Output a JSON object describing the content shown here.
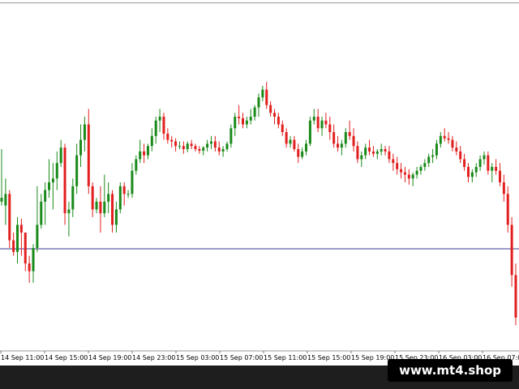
{
  "chart_data": {
    "type": "candlestick",
    "timeframe_label_note": "",
    "time_labels": [
      "14 Sep 11:00",
      "14 Sep 15:00",
      "14 Sep 19:00",
      "14 Sep 23:00",
      "15 Sep 03:00",
      "15 Sep 07:00",
      "15 Sep 11:00",
      "15 Sep 15:00",
      "15 Sep 19:00",
      "15 Sep 23:00",
      "16 Sep 03:00",
      "16 Sep 07:00"
    ],
    "ylim": [
      0,
      451
    ],
    "level_line": 129,
    "candles_per_label": 13.5,
    "candles": [
      [
        0,
        190,
        258,
        185,
        195
      ],
      [
        1,
        185,
        220,
        160,
        200
      ],
      [
        2,
        200,
        205,
        130,
        140
      ],
      [
        3,
        140,
        150,
        120,
        125
      ],
      [
        4,
        125,
        170,
        110,
        160
      ],
      [
        5,
        160,
        168,
        120,
        150
      ],
      [
        6,
        150,
        150,
        100,
        110
      ],
      [
        7,
        110,
        120,
        85,
        100
      ],
      [
        8,
        100,
        135,
        85,
        130
      ],
      [
        9,
        130,
        210,
        125,
        160
      ],
      [
        10,
        160,
        200,
        155,
        190
      ],
      [
        11,
        190,
        215,
        160,
        205
      ],
      [
        12,
        205,
        245,
        195,
        215
      ],
      [
        13,
        215,
        240,
        180,
        220
      ],
      [
        14,
        220,
        255,
        205,
        240
      ],
      [
        15,
        240,
        270,
        235,
        260
      ],
      [
        16,
        260,
        265,
        160,
        175
      ],
      [
        17,
        175,
        190,
        145,
        180
      ],
      [
        18,
        180,
        220,
        170,
        210
      ],
      [
        19,
        210,
        265,
        200,
        250
      ],
      [
        20,
        250,
        290,
        235,
        270
      ],
      [
        21,
        270,
        300,
        255,
        290
      ],
      [
        22,
        290,
        310,
        200,
        210
      ],
      [
        23,
        210,
        215,
        170,
        180
      ],
      [
        24,
        180,
        195,
        175,
        190
      ],
      [
        25,
        190,
        210,
        150,
        175
      ],
      [
        26,
        175,
        225,
        170,
        190
      ],
      [
        27,
        190,
        215,
        175,
        200
      ],
      [
        28,
        200,
        205,
        150,
        160
      ],
      [
        29,
        160,
        190,
        150,
        180
      ],
      [
        30,
        180,
        215,
        175,
        210
      ],
      [
        31,
        210,
        215,
        185,
        200
      ],
      [
        32,
        200,
        205,
        195,
        200
      ],
      [
        33,
        200,
        240,
        195,
        230
      ],
      [
        34,
        230,
        250,
        225,
        245
      ],
      [
        35,
        245,
        270,
        240,
        255
      ],
      [
        36,
        255,
        265,
        240,
        250
      ],
      [
        37,
        250,
        265,
        245,
        262
      ],
      [
        38,
        262,
        285,
        255,
        275
      ],
      [
        39,
        275,
        300,
        265,
        295
      ],
      [
        40,
        295,
        310,
        280,
        300
      ],
      [
        41,
        300,
        305,
        270,
        278
      ],
      [
        42,
        278,
        285,
        265,
        270
      ],
      [
        43,
        270,
        275,
        260,
        268
      ],
      [
        44,
        268,
        272,
        255,
        262
      ],
      [
        45,
        262,
        268,
        258,
        262
      ],
      [
        46,
        262,
        268,
        252,
        258
      ],
      [
        47,
        258,
        268,
        254,
        265
      ],
      [
        48,
        265,
        270,
        258,
        262
      ],
      [
        49,
        262,
        265,
        255,
        258
      ],
      [
        50,
        258,
        262,
        252,
        256
      ],
      [
        51,
        256,
        262,
        250,
        260
      ],
      [
        52,
        260,
        270,
        255,
        265
      ],
      [
        53,
        265,
        275,
        258,
        268
      ],
      [
        54,
        268,
        275,
        255,
        260
      ],
      [
        55,
        260,
        268,
        250,
        255
      ],
      [
        56,
        255,
        262,
        248,
        258
      ],
      [
        57,
        258,
        268,
        255,
        265
      ],
      [
        58,
        265,
        290,
        260,
        285
      ],
      [
        59,
        285,
        305,
        275,
        300
      ],
      [
        60,
        300,
        315,
        290,
        298
      ],
      [
        61,
        298,
        305,
        285,
        290
      ],
      [
        62,
        290,
        300,
        285,
        295
      ],
      [
        63,
        295,
        310,
        290,
        300
      ],
      [
        64,
        300,
        315,
        295,
        312
      ],
      [
        65,
        312,
        330,
        300,
        325
      ],
      [
        66,
        325,
        340,
        320,
        335
      ],
      [
        67,
        335,
        345,
        310,
        315
      ],
      [
        68,
        315,
        320,
        300,
        305
      ],
      [
        69,
        305,
        310,
        290,
        300
      ],
      [
        70,
        300,
        305,
        285,
        290
      ],
      [
        71,
        290,
        295,
        275,
        280
      ],
      [
        72,
        280,
        285,
        260,
        265
      ],
      [
        73,
        265,
        275,
        260,
        270
      ],
      [
        74,
        270,
        275,
        255,
        258
      ],
      [
        75,
        258,
        265,
        240,
        248
      ],
      [
        76,
        248,
        260,
        245,
        255
      ],
      [
        77,
        255,
        270,
        250,
        265
      ],
      [
        78,
        265,
        300,
        262,
        295
      ],
      [
        79,
        295,
        310,
        290,
        300
      ],
      [
        80,
        300,
        310,
        280,
        285
      ],
      [
        81,
        285,
        300,
        275,
        295
      ],
      [
        82,
        295,
        305,
        285,
        290
      ],
      [
        83,
        290,
        300,
        270,
        280
      ],
      [
        84,
        280,
        290,
        260,
        265
      ],
      [
        85,
        265,
        275,
        255,
        260
      ],
      [
        86,
        260,
        270,
        250,
        265
      ],
      [
        87,
        265,
        285,
        260,
        280
      ],
      [
        88,
        280,
        295,
        270,
        275
      ],
      [
        89,
        275,
        285,
        255,
        262
      ],
      [
        90,
        262,
        268,
        240,
        245
      ],
      [
        91,
        245,
        255,
        235,
        250
      ],
      [
        92,
        250,
        265,
        245,
        260
      ],
      [
        93,
        260,
        270,
        250,
        255
      ],
      [
        94,
        255,
        262,
        248,
        252
      ],
      [
        95,
        252,
        258,
        245,
        255
      ],
      [
        96,
        255,
        265,
        250,
        258
      ],
      [
        97,
        258,
        262,
        250,
        255
      ],
      [
        98,
        255,
        262,
        240,
        245
      ],
      [
        99,
        245,
        252,
        230,
        240
      ],
      [
        100,
        240,
        248,
        225,
        232
      ],
      [
        101,
        232,
        240,
        220,
        228
      ],
      [
        102,
        228,
        235,
        215,
        225
      ],
      [
        103,
        225,
        232,
        212,
        220
      ],
      [
        104,
        220,
        228,
        210,
        225
      ],
      [
        105,
        225,
        235,
        220,
        230
      ],
      [
        106,
        230,
        238,
        225,
        235
      ],
      [
        107,
        235,
        245,
        230,
        240
      ],
      [
        108,
        240,
        252,
        235,
        248
      ],
      [
        109,
        248,
        258,
        240,
        250
      ],
      [
        110,
        250,
        270,
        245,
        265
      ],
      [
        111,
        265,
        280,
        260,
        275
      ],
      [
        112,
        275,
        285,
        268,
        272
      ],
      [
        113,
        272,
        280,
        265,
        270
      ],
      [
        114,
        270,
        275,
        255,
        260
      ],
      [
        115,
        260,
        268,
        250,
        255
      ],
      [
        116,
        255,
        262,
        240,
        245
      ],
      [
        117,
        245,
        252,
        230,
        235
      ],
      [
        118,
        235,
        240,
        215,
        222
      ],
      [
        119,
        222,
        232,
        215,
        228
      ],
      [
        120,
        228,
        240,
        222,
        235
      ],
      [
        121,
        235,
        250,
        230,
        245
      ],
      [
        122,
        245,
        255,
        238,
        250
      ],
      [
        123,
        250,
        255,
        225,
        230
      ],
      [
        124,
        230,
        240,
        215,
        235
      ],
      [
        125,
        235,
        245,
        225,
        230
      ],
      [
        126,
        230,
        240,
        210,
        215
      ],
      [
        127,
        215,
        225,
        190,
        200
      ],
      [
        128,
        200,
        210,
        150,
        160
      ],
      [
        129,
        160,
        170,
        80,
        95
      ],
      [
        130,
        95,
        110,
        30,
        40
      ]
    ]
  },
  "watermark": {
    "text": "www.mt4.shop"
  }
}
